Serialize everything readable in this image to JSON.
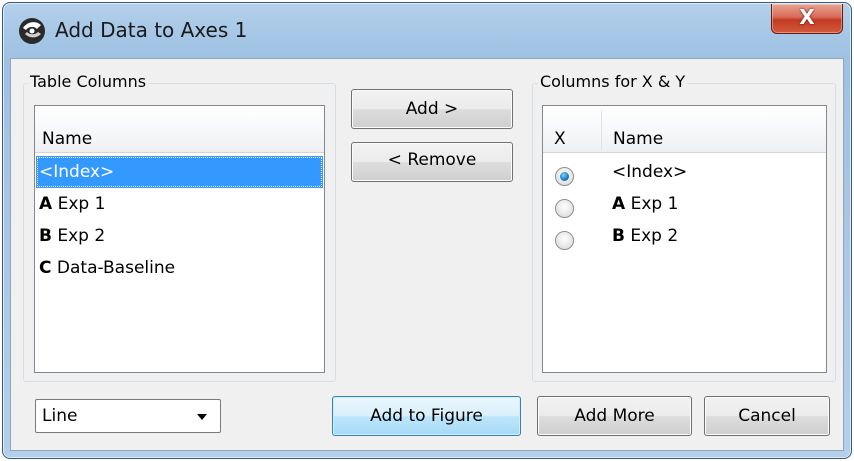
{
  "window": {
    "title": "Add Data to Axes 1",
    "close_symbol": "X",
    "icon": "app-logo-icon"
  },
  "table_columns": {
    "group_label": "Table Columns",
    "header": "Name",
    "items": [
      {
        "letter": "",
        "name": "<Index>",
        "selected": true
      },
      {
        "letter": "A",
        "name": "Exp 1",
        "selected": false
      },
      {
        "letter": "B",
        "name": "Exp 2",
        "selected": false
      },
      {
        "letter": "C",
        "name": "Data-Baseline",
        "selected": false
      }
    ]
  },
  "middle_buttons": {
    "add_label": "Add >",
    "remove_label": "< Remove"
  },
  "xy_columns": {
    "group_label": "Columns for X & Y",
    "header_x": "X",
    "header_name": "Name",
    "items": [
      {
        "letter": "",
        "name": "<Index>",
        "is_x": true
      },
      {
        "letter": "A",
        "name": "Exp 1",
        "is_x": false
      },
      {
        "letter": "B",
        "name": "Exp 2",
        "is_x": false
      }
    ]
  },
  "footer": {
    "plot_type_value": "Line",
    "add_to_figure_label": "Add to Figure",
    "add_more_label": "Add More",
    "cancel_label": "Cancel"
  },
  "colors": {
    "selection": "#3399ff",
    "close_button": "#c33a22",
    "title_bar": "#a6c7e6"
  }
}
